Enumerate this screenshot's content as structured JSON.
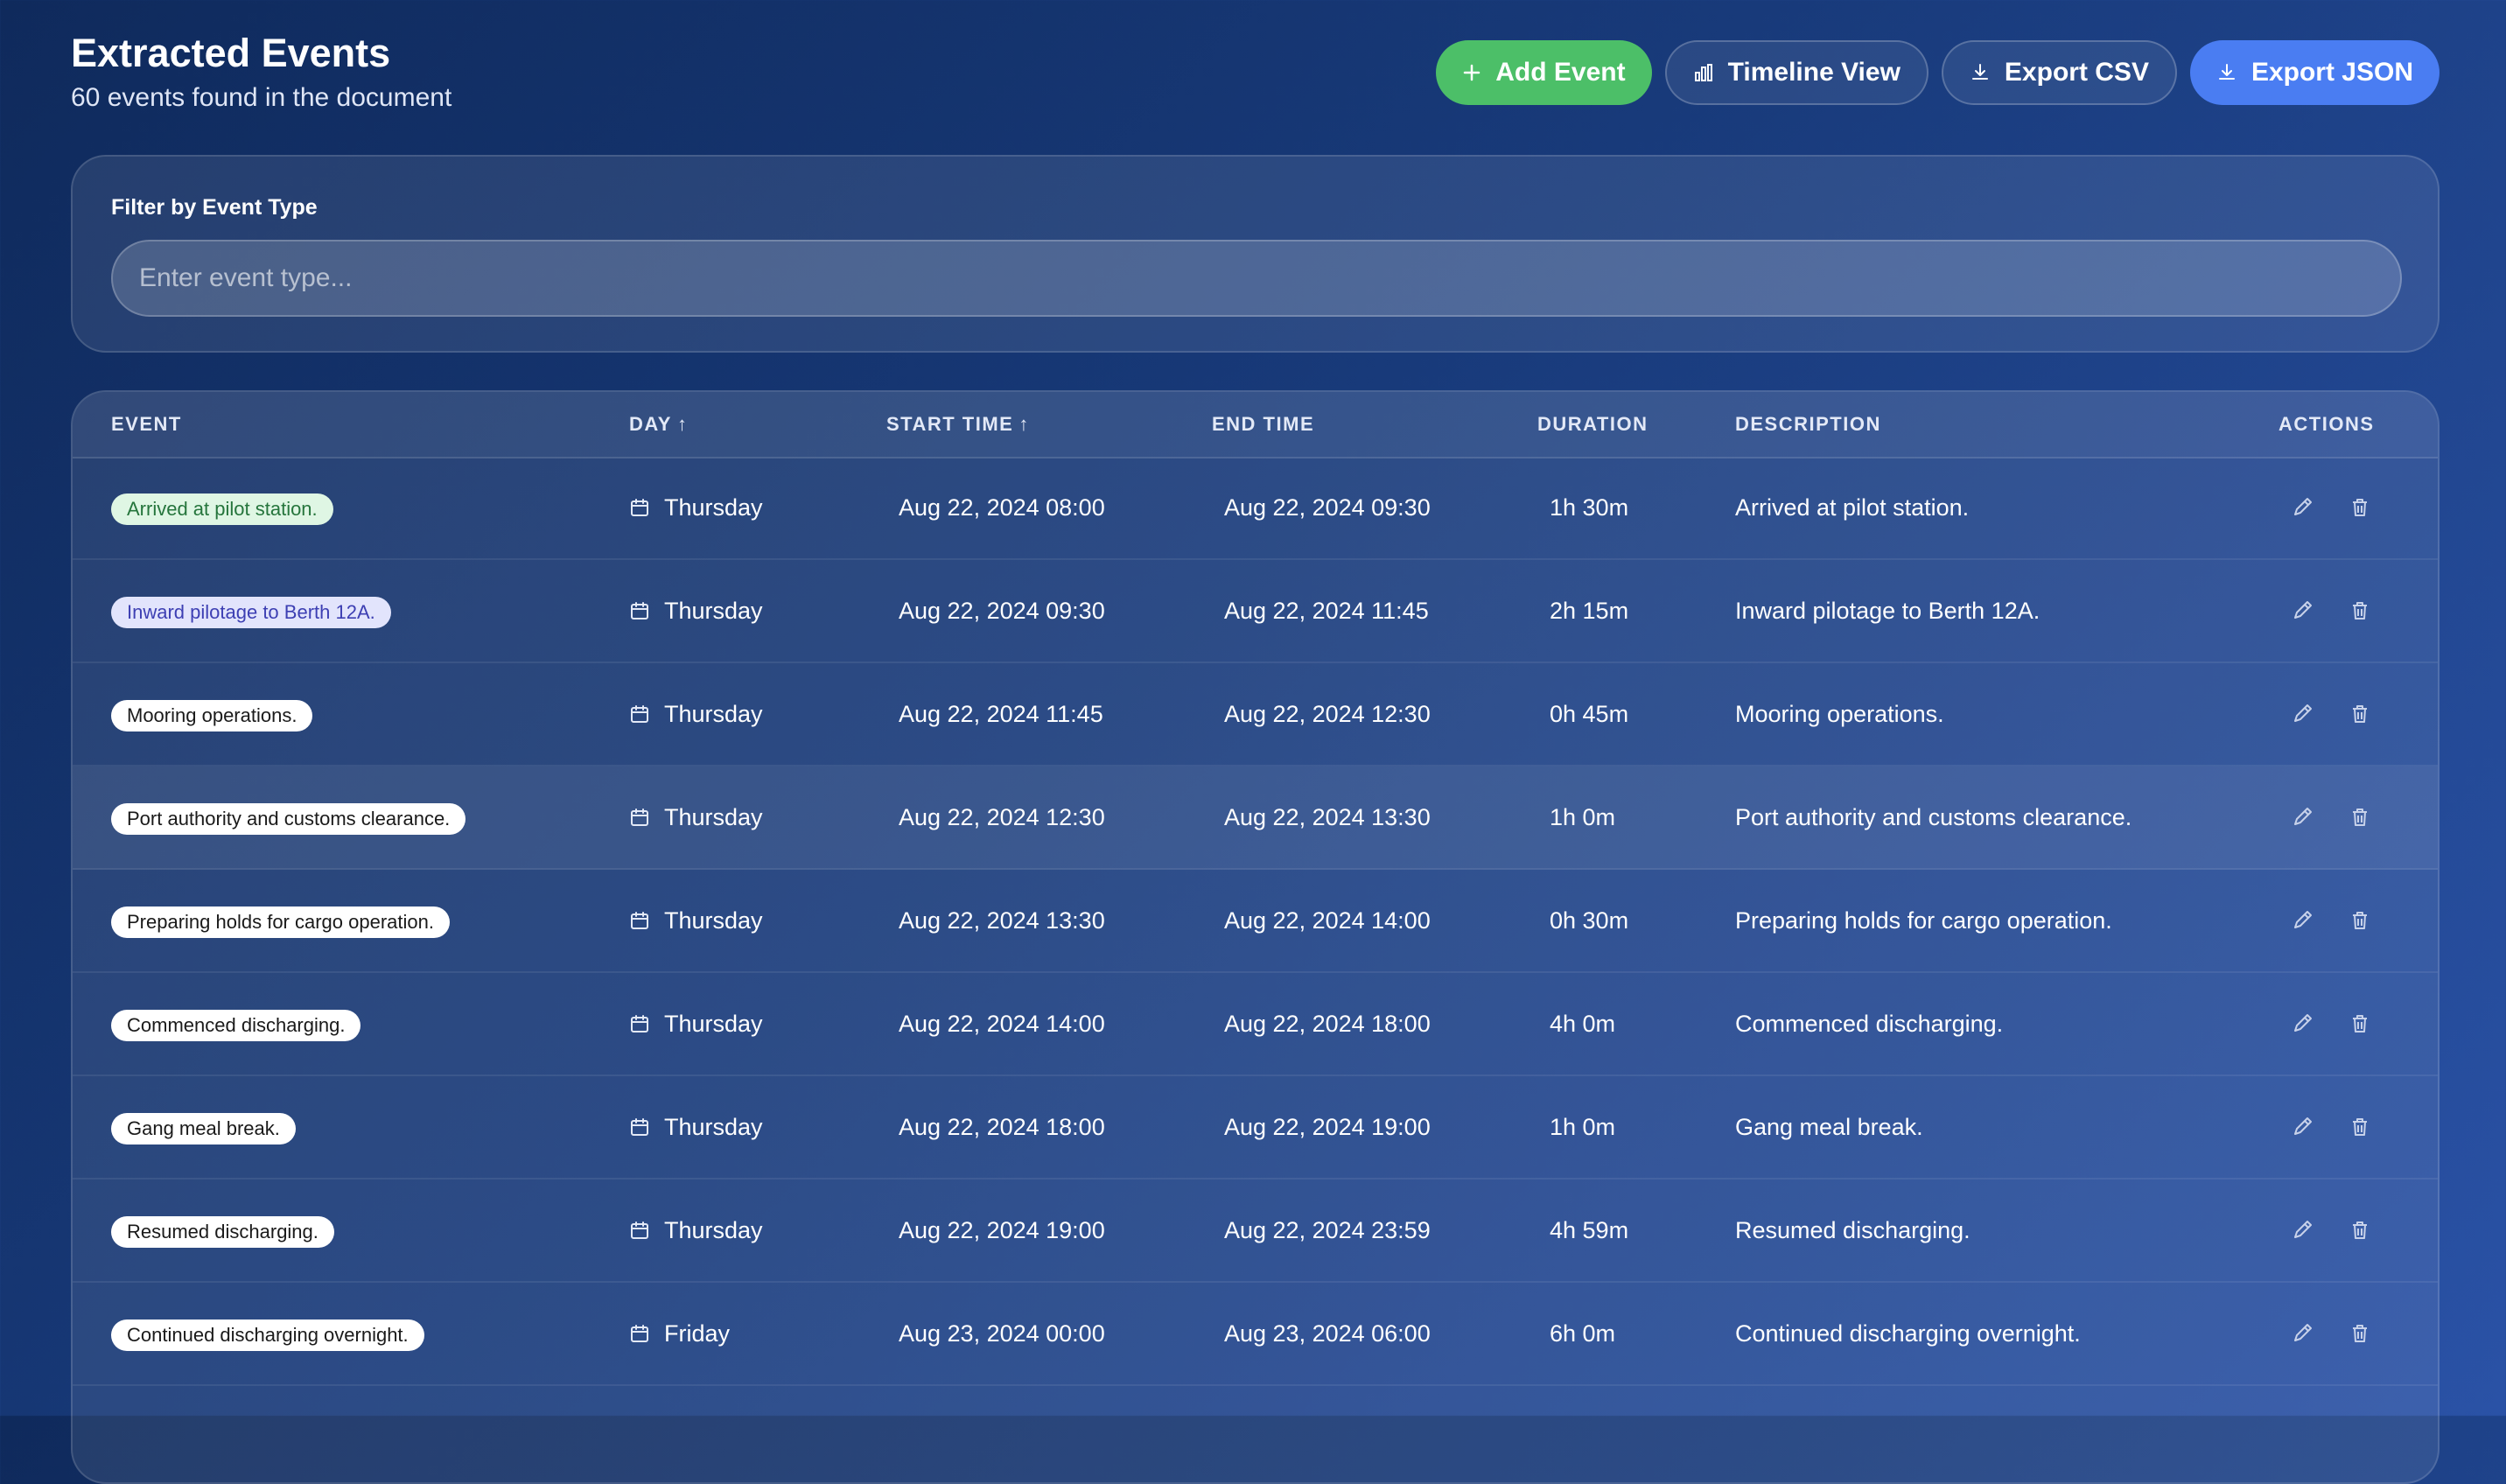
{
  "header": {
    "title": "Extracted Events",
    "subtitle": "60 events found in the document"
  },
  "toolbar": {
    "add_label": "Add Event",
    "timeline_label": "Timeline View",
    "export_csv_label": "Export CSV",
    "export_json_label": "Export JSON",
    "colors": {
      "add": "#4cbf68",
      "export_json": "#4a7df2"
    }
  },
  "filter": {
    "label": "Filter by Event Type",
    "placeholder": "Enter event type...",
    "value": ""
  },
  "table": {
    "columns": {
      "event": "EVENT",
      "day": "DAY",
      "start": "START TIME",
      "end": "END TIME",
      "duration": "DURATION",
      "description": "DESCRIPTION",
      "actions": "ACTIONS"
    },
    "sort_arrow": "↑",
    "rows": [
      {
        "event": "Arrived at pilot station.",
        "day": "Thursday",
        "start": "Aug 22, 2024 08:00",
        "end": "Aug 22, 2024 09:30",
        "duration": "1h 30m",
        "description": "Arrived at pilot station."
      },
      {
        "event": "Inward pilotage to Berth 12A.",
        "day": "Thursday",
        "start": "Aug 22, 2024 09:30",
        "end": "Aug 22, 2024 11:45",
        "duration": "2h 15m",
        "description": "Inward pilotage to Berth 12A."
      },
      {
        "event": "Mooring operations.",
        "day": "Thursday",
        "start": "Aug 22, 2024 11:45",
        "end": "Aug 22, 2024 12:30",
        "duration": "0h 45m",
        "description": "Mooring operations."
      },
      {
        "event": "Port authority and customs clearance.",
        "day": "Thursday",
        "start": "Aug 22, 2024 12:30",
        "end": "Aug 22, 2024 13:30",
        "duration": "1h 0m",
        "description": "Port authority and customs clearance."
      },
      {
        "event": "Preparing holds for cargo operation.",
        "day": "Thursday",
        "start": "Aug 22, 2024 13:30",
        "end": "Aug 22, 2024 14:00",
        "duration": "0h 30m",
        "description": "Preparing holds for cargo operation."
      },
      {
        "event": "Commenced discharging.",
        "day": "Thursday",
        "start": "Aug 22, 2024 14:00",
        "end": "Aug 22, 2024 18:00",
        "duration": "4h 0m",
        "description": "Commenced discharging."
      },
      {
        "event": "Gang meal break.",
        "day": "Thursday",
        "start": "Aug 22, 2024 18:00",
        "end": "Aug 22, 2024 19:00",
        "duration": "1h 0m",
        "description": "Gang meal break."
      },
      {
        "event": "Resumed discharging.",
        "day": "Thursday",
        "start": "Aug 22, 2024 19:00",
        "end": "Aug 22, 2024 23:59",
        "duration": "4h 59m",
        "description": "Resumed discharging."
      },
      {
        "event": "Continued discharging overnight.",
        "day": "Friday",
        "start": "Aug 23, 2024 00:00",
        "end": "Aug 23, 2024 06:00",
        "duration": "6h 0m",
        "description": "Continued discharging overnight."
      }
    ]
  },
  "badge_colors": {
    "green": "#dff6e4",
    "indigo": "#e2e4fc",
    "default": "#ffffff"
  },
  "icons": {
    "add": "plus-icon",
    "timeline": "bar-chart-icon",
    "export": "download-icon",
    "day": "calendar-icon",
    "edit": "pencil-icon",
    "delete": "trash-icon"
  }
}
